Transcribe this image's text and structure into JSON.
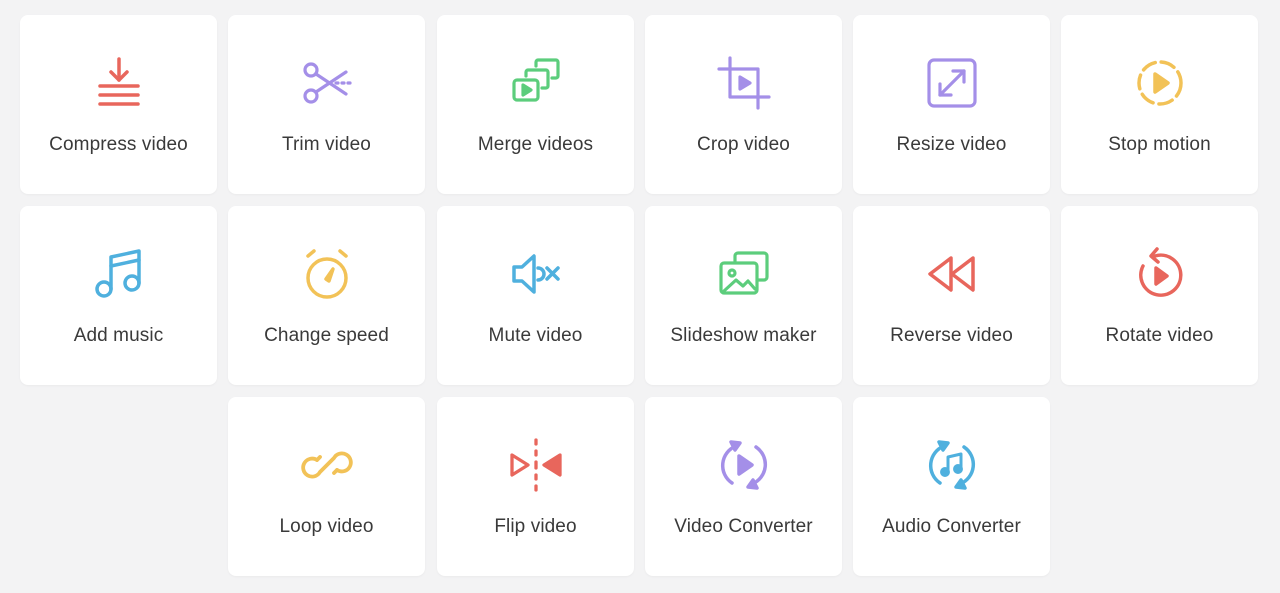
{
  "colors": {
    "red": "#e8665c",
    "purple": "#a48fe8",
    "green": "#5ccd7c",
    "yellow": "#f2c257",
    "blue": "#4fb0de",
    "text": "#3a3a3a",
    "background": "#f3f3f4",
    "card": "#ffffff"
  },
  "tools": [
    {
      "label": "Compress video",
      "icon": "compress-icon"
    },
    {
      "label": "Trim video",
      "icon": "scissors-icon"
    },
    {
      "label": "Merge videos",
      "icon": "merge-icon"
    },
    {
      "label": "Crop video",
      "icon": "crop-icon"
    },
    {
      "label": "Resize video",
      "icon": "resize-icon"
    },
    {
      "label": "Stop motion",
      "icon": "stop-motion-icon"
    },
    {
      "label": "Add music",
      "icon": "music-note-icon"
    },
    {
      "label": "Change speed",
      "icon": "stopwatch-icon"
    },
    {
      "label": "Mute video",
      "icon": "speaker-mute-icon"
    },
    {
      "label": "Slideshow maker",
      "icon": "slideshow-icon"
    },
    {
      "label": "Reverse video",
      "icon": "rewind-icon"
    },
    {
      "label": "Rotate video",
      "icon": "rotate-icon"
    },
    {
      "label": "Loop video",
      "icon": "infinity-icon"
    },
    {
      "label": "Flip video",
      "icon": "flip-icon"
    },
    {
      "label": "Video Converter",
      "icon": "video-converter-icon"
    },
    {
      "label": "Audio Converter",
      "icon": "audio-converter-icon"
    }
  ]
}
